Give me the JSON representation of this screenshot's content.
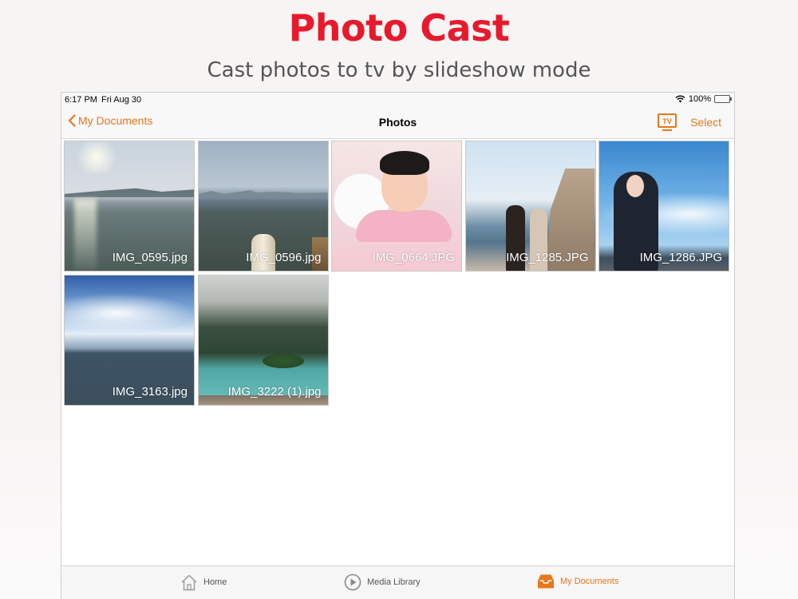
{
  "promo": {
    "title": "Photo Cast",
    "subtitle": "Cast photos to tv by slideshow mode"
  },
  "status_bar": {
    "time": "6:17 PM",
    "date": "Fri Aug 30",
    "battery": "100%",
    "battery_level": 1.0
  },
  "nav": {
    "back_label": "My Documents",
    "title": "Photos",
    "tv_label": "TV",
    "select_label": "Select"
  },
  "photos": [
    {
      "name": "IMG_0595.jpg"
    },
    {
      "name": "IMG_0596.jpg"
    },
    {
      "name": "IMG_0664.JPG"
    },
    {
      "name": "IMG_1285.JPG"
    },
    {
      "name": "IMG_1286.JPG"
    },
    {
      "name": "IMG_3163.jpg"
    },
    {
      "name": "IMG_3222 (1).jpg"
    }
  ],
  "tabs": [
    {
      "label": "Home",
      "icon": "house-icon",
      "active": false
    },
    {
      "label": "Media Library",
      "icon": "play-circle-icon",
      "active": false
    },
    {
      "label": "My Documents",
      "icon": "inbox-tray-icon",
      "active": true
    }
  ],
  "colors": {
    "headline": "#e8192c",
    "accent": "#e8761a",
    "battery_fill": "#4cd964"
  }
}
